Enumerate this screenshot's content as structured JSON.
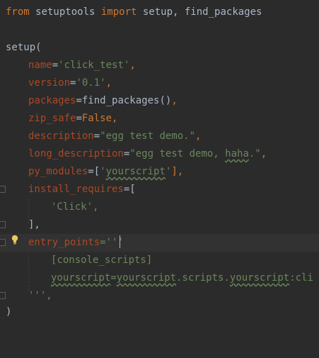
{
  "code": {
    "line_import": {
      "kw_from": "from",
      "mod": " setuptools ",
      "kw_import": "import",
      "names": " setup, find_packages"
    },
    "line_setup": "setup(",
    "args": [
      {
        "key": "name",
        "eq": "=",
        "val": "'click_test'",
        "tail": ","
      },
      {
        "key": "version",
        "eq": "=",
        "val": "'0.1'",
        "tail": ","
      },
      {
        "key": "packages",
        "eq": "=",
        "val": "find_packages()",
        "tail": ","
      },
      {
        "key": "zip_safe",
        "eq": "=",
        "val": "False",
        "tail": ","
      },
      {
        "key": "description",
        "eq": "=",
        "val": "\"egg test demo.\"",
        "tail": ","
      },
      {
        "key": "long_description",
        "eq": "=",
        "val_a": "\"egg test demo, ",
        "val_b": "haha",
        "val_c": ".\"",
        "tail": ","
      },
      {
        "key": "py_modules",
        "eq": "=",
        "pre": "[",
        "val_a": "'",
        "val_b": "yourscript",
        "val_c": "'",
        "tail": "],"
      }
    ],
    "install_requires_key": "install_requires",
    "install_requires_open": "=[",
    "install_requires_item": "'Click',",
    "install_requires_close": "],",
    "entry_points_key": "entry_points",
    "entry_points_open": "='''",
    "entry_console": "[console_scripts]",
    "entry_line_a": "yourscript",
    "entry_line_b": "=",
    "entry_line_c": "yourscript",
    "entry_line_d": ".scripts.",
    "entry_line_e": "yourscript",
    "entry_line_f": ":cli",
    "entry_points_close": "''',",
    "close_paren": ")"
  },
  "icons": {
    "fold": "fold-marker-icon",
    "bulb": "lightbulb-icon"
  },
  "colors": {
    "background": "#2b2b2b",
    "keyword": "#cc7832",
    "param": "#aa4926",
    "string": "#6a8759",
    "text": "#a9b7c6"
  }
}
